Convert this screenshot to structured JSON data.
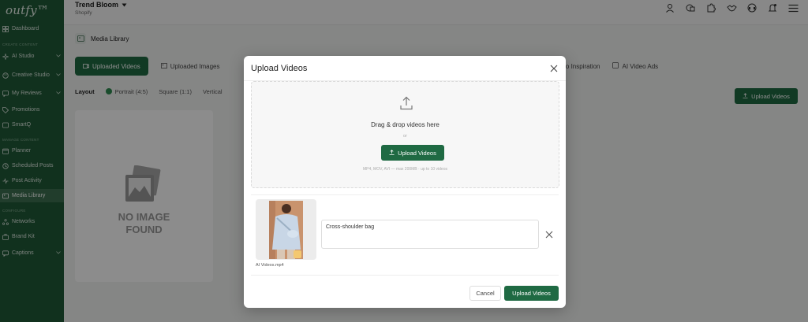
{
  "app": {
    "logo": "outfy™"
  },
  "sidebar": {
    "items": [
      {
        "label": "Dashboard"
      },
      {
        "label": "AI Studio"
      },
      {
        "label": "Creative Studio"
      },
      {
        "label": "My Reviews"
      },
      {
        "label": "Promotions"
      },
      {
        "label": "SmartQ"
      },
      {
        "label": "Planner"
      },
      {
        "label": "Scheduled Posts"
      },
      {
        "label": "Post Activity"
      },
      {
        "label": "Media Library"
      },
      {
        "label": "Networks"
      },
      {
        "label": "Brand Kit"
      },
      {
        "label": "Captions"
      }
    ],
    "sections": {
      "create": "Create Content",
      "manage": "Manage Content",
      "configure": "Configure"
    }
  },
  "topbar": {
    "store_name": "Trend Bloom",
    "store_platform": "Shopify"
  },
  "page": {
    "title": "Media Library",
    "tabs": [
      "Uploaded Videos",
      "Uploaded Images"
    ],
    "tabs_right": [
      "deo Inspiration",
      "AI Video Ads"
    ],
    "layout_label": "Layout",
    "layout_options": [
      "Portrait (4:5)",
      "Square (1:1)",
      "Vertical"
    ],
    "upload_button": "Upload Videos",
    "no_image_line1": "NO IMAGE",
    "no_image_line2": "FOUND"
  },
  "modal": {
    "title": "Upload Videos",
    "dropzone_text": "Drag & drop videos here",
    "dropzone_or": "or",
    "dropzone_button": "Upload Videos",
    "dropzone_hint": "MP4, MOV, AVI — max 200MB · up to 10 videos",
    "file": {
      "name": "AI Videos.mp4",
      "description": "Cross-shoulder bag"
    },
    "cancel_label": "Cancel",
    "submit_label": "Upload Videos"
  },
  "colors": {
    "brand": "#1f6a43",
    "sidebar": "#1f5a37"
  }
}
